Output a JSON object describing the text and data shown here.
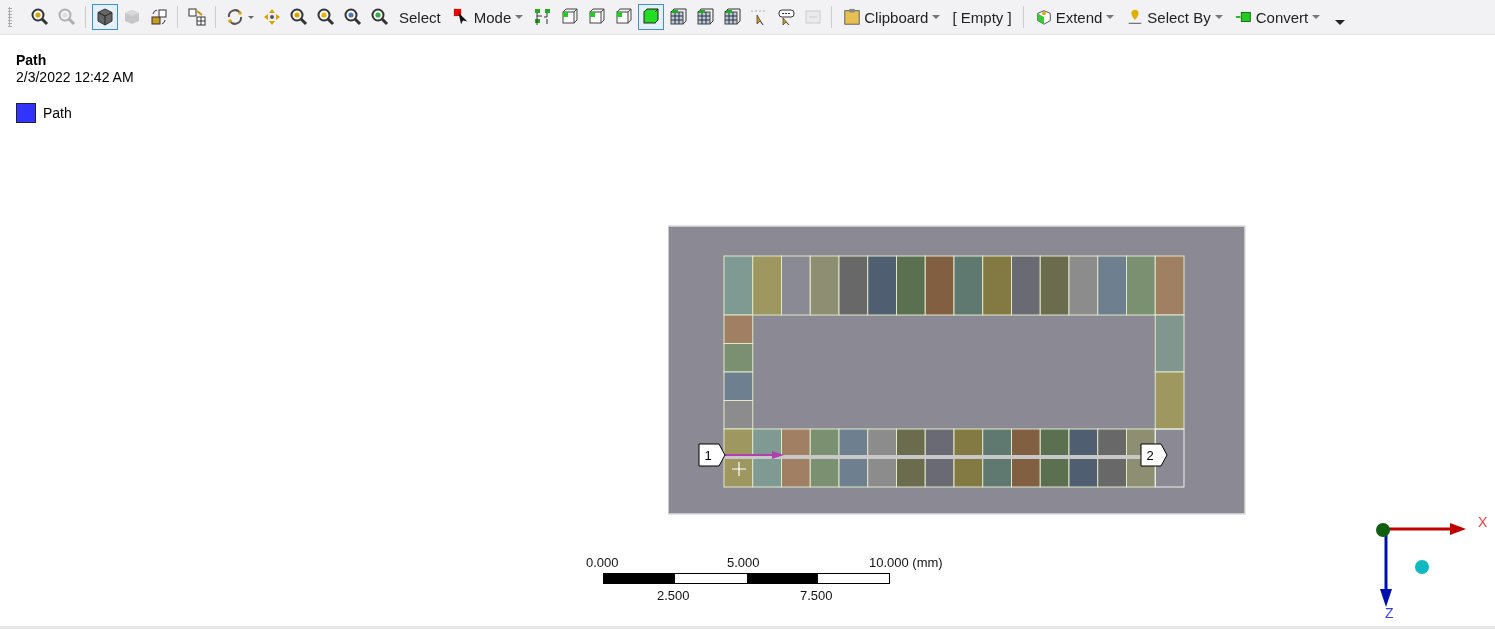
{
  "toolbar": {
    "groups": [
      [
        {
          "kind": "icon",
          "selected": false,
          "disabled": false
        },
        {
          "kind": "icon",
          "selected": false,
          "disabled": true
        }
      ],
      [
        {
          "kind": "icon",
          "selected": true,
          "disabled": false
        },
        {
          "kind": "icon",
          "selected": false,
          "disabled": true
        },
        {
          "kind": "icon",
          "selected": false,
          "disabled": false
        }
      ],
      [
        {
          "kind": "icon",
          "selected": false,
          "disabled": false
        }
      ],
      [
        {
          "kind": "icon",
          "selected": false,
          "disabled": false
        },
        {
          "kind": "icon",
          "selected": false,
          "disabled": false
        },
        {
          "kind": "icon",
          "selected": false,
          "disabled": false
        },
        {
          "kind": "icon",
          "selected": false,
          "disabled": false
        },
        {
          "kind": "icon",
          "selected": false,
          "disabled": false
        },
        {
          "kind": "icon",
          "selected": false,
          "disabled": false
        }
      ],
      [
        {
          "kind": "text",
          "label": "Select"
        },
        {
          "kind": "menu",
          "label": "Mode"
        },
        {
          "kind": "icon",
          "selected": false,
          "disabled": false
        },
        {
          "kind": "icon",
          "selected": false,
          "disabled": false
        },
        {
          "kind": "icon",
          "selected": false,
          "disabled": false
        },
        {
          "kind": "icon",
          "selected": false,
          "disabled": false
        },
        {
          "kind": "icon",
          "selected": true,
          "disabled": false
        },
        {
          "kind": "icon",
          "selected": false,
          "disabled": false
        },
        {
          "kind": "icon",
          "selected": false,
          "disabled": false
        },
        {
          "kind": "icon",
          "selected": false,
          "disabled": false
        },
        {
          "kind": "icon",
          "selected": false,
          "disabled": false
        },
        {
          "kind": "icon",
          "selected": false,
          "disabled": false
        },
        {
          "kind": "icon",
          "selected": false,
          "disabled": true
        }
      ],
      [
        {
          "kind": "menu",
          "label": "Clipboard"
        },
        {
          "kind": "text",
          "label": "[ Empty ]"
        }
      ],
      [
        {
          "kind": "menu",
          "label": "Extend"
        },
        {
          "kind": "menu",
          "label": "Select By"
        },
        {
          "kind": "menu",
          "label": "Convert"
        },
        {
          "kind": "icon",
          "selected": false,
          "disabled": false
        }
      ]
    ]
  },
  "result": {
    "title": "Path",
    "timestamp": "2/3/2022 12:42 AM",
    "legend": [
      {
        "label": "Path",
        "color": "#3333ff"
      }
    ]
  },
  "viewport": {
    "path_markers": [
      "1",
      "2"
    ],
    "scale_bar": {
      "top_labels": [
        "0.000",
        "5.000",
        "10.000 (mm)"
      ],
      "bottom_labels": [
        "2.500",
        "7.500"
      ]
    },
    "axes": [
      "X",
      "Z"
    ]
  }
}
